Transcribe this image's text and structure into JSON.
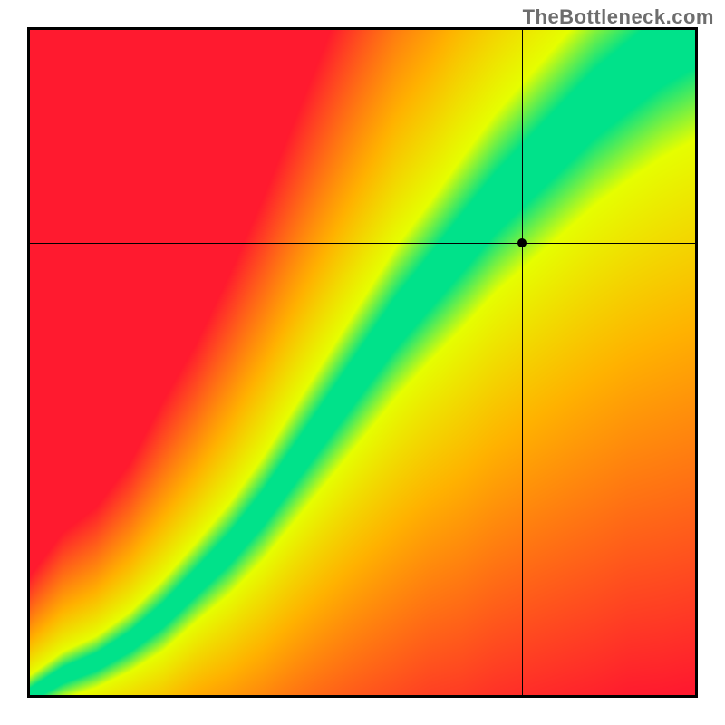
{
  "brand": "TheBottleneck.com",
  "chart_data": {
    "type": "heatmap",
    "title": "",
    "xlabel": "",
    "ylabel": "",
    "xlim": [
      0,
      1
    ],
    "ylim": [
      0,
      1
    ],
    "grid": false,
    "legend": false,
    "marker": {
      "x": 0.74,
      "y": 0.68
    },
    "ridge": {
      "description": "Green optimal band runs from bottom-left to upper-right; band midline and half-width sampled at x in [0,1].",
      "x": [
        0.0,
        0.05,
        0.1,
        0.15,
        0.2,
        0.25,
        0.3,
        0.35,
        0.4,
        0.45,
        0.5,
        0.55,
        0.6,
        0.65,
        0.7,
        0.75,
        0.8,
        0.85,
        0.9,
        0.95,
        1.0
      ],
      "center_y": [
        0.0,
        0.03,
        0.05,
        0.08,
        0.12,
        0.17,
        0.22,
        0.28,
        0.35,
        0.42,
        0.49,
        0.56,
        0.62,
        0.68,
        0.74,
        0.79,
        0.84,
        0.89,
        0.93,
        0.97,
        1.0
      ],
      "half_width": [
        0.01,
        0.012,
        0.013,
        0.015,
        0.018,
        0.02,
        0.023,
        0.026,
        0.029,
        0.032,
        0.035,
        0.038,
        0.04,
        0.043,
        0.045,
        0.047,
        0.049,
        0.051,
        0.052,
        0.054,
        0.055
      ]
    },
    "colors": {
      "optimal": "#00e28a",
      "near": "#e6ff00",
      "warn": "#ffb400",
      "bad": "#ff1a2f"
    }
  }
}
